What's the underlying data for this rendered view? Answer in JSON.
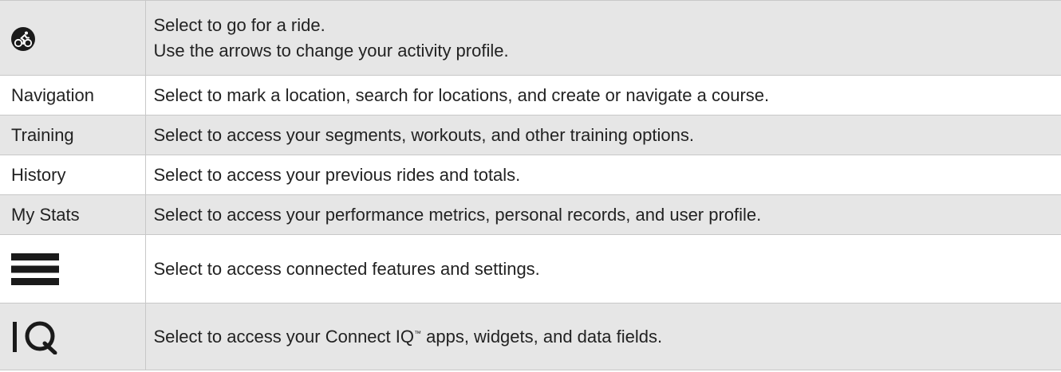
{
  "rows": [
    {
      "icon": "bike-icon",
      "description_lines": [
        "Select to go for a ride.",
        "Use the arrows to change your activity profile."
      ]
    },
    {
      "label": "Navigation",
      "description": "Select to mark a location, search for locations, and create or navigate a course."
    },
    {
      "label": "Training",
      "description": "Select to access your segments, workouts, and other training options."
    },
    {
      "label": "History",
      "description": "Select to access your previous rides and totals."
    },
    {
      "label": "My Stats",
      "description": "Select to access your performance metrics, personal records, and user profile."
    },
    {
      "icon": "menu-icon",
      "description": "Select to access connected features and settings."
    },
    {
      "icon": "connect-iq-icon",
      "description_before": "Select to access your Connect IQ",
      "trademark": "™",
      "description_after": " apps, widgets, and data fields."
    }
  ],
  "colors": {
    "shade": "#e6e6e6",
    "border": "#c8c8c8",
    "text": "#222222",
    "icon": "#1a1a1a"
  }
}
